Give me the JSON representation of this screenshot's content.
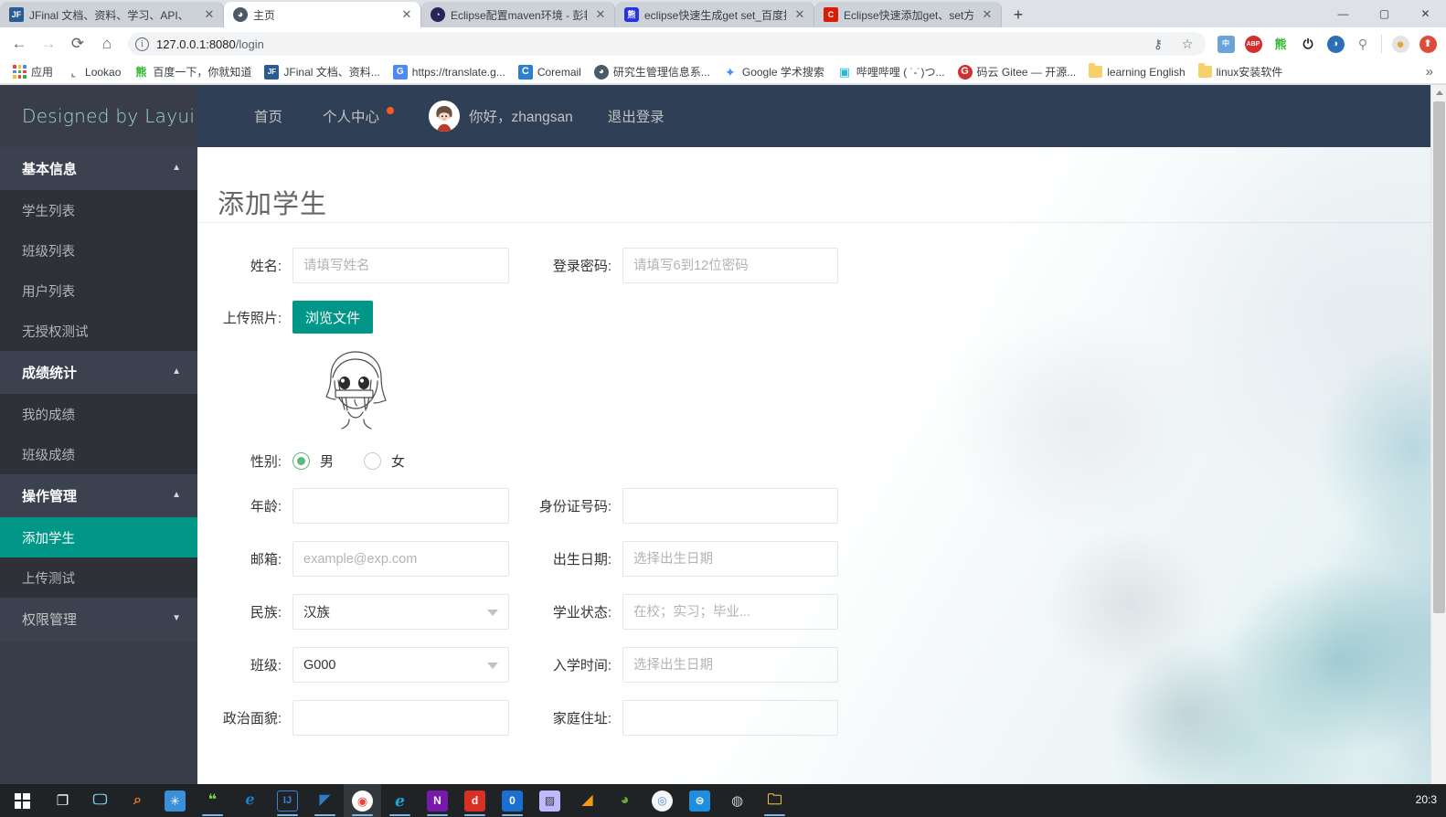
{
  "browser": {
    "tabs": [
      {
        "title": "JFinal 文档、资料、学习、API、",
        "favicon": "jfinal-icon",
        "active": false
      },
      {
        "title": "主页",
        "favicon": "home-globe-icon",
        "active": true
      },
      {
        "title": "Eclipse配置maven环境 - 彭艳 -",
        "favicon": "eclipse-icon",
        "active": false
      },
      {
        "title": "eclipse快速生成get set_百度搜索",
        "favicon": "baidu-icon",
        "active": false
      },
      {
        "title": "Eclipse快速添加get、set方法 - ",
        "favicon": "csdn-icon",
        "active": false
      }
    ],
    "new_tab_label": "+",
    "window_controls": {
      "minimize": "—",
      "maximize": "▢",
      "close": "✕"
    },
    "nav": {
      "back": "←",
      "forward": "→",
      "reload": "⟳",
      "home": "⌂"
    },
    "address": {
      "protocol_icon": "info-circle-icon",
      "host": "127.0.0.1:8080",
      "path": "/login"
    },
    "omnibox_actions": [
      {
        "name": "password-key-icon",
        "glyph": "⚷"
      },
      {
        "name": "bookmark-star-icon",
        "glyph": "☆"
      }
    ],
    "extensions": [
      {
        "name": "ime-extension-icon",
        "label": "中",
        "color": "#6aa3d8"
      },
      {
        "name": "adblock-plus-icon",
        "label": "ABP",
        "color": "#d32f2f"
      },
      {
        "name": "baidu-extension-icon",
        "label": "熊",
        "color": "#2eb82e"
      },
      {
        "name": "power-extension-icon",
        "label": "⏻",
        "color": "#2b2b2b"
      },
      {
        "name": "screenshot-extension-icon",
        "label": "◑",
        "color": "#2c6fb5"
      },
      {
        "name": "lightbulb-extension-icon",
        "label": "💡",
        "color": "#777777"
      },
      {
        "name": "profile-avatar-icon",
        "label": "●",
        "color": "#e8a33d"
      },
      {
        "name": "chrome-menu-icon",
        "label": "⬆",
        "color": "#e04a3a"
      }
    ],
    "bookmarks": [
      {
        "label": "应用",
        "icon": "apps-grid-icon"
      },
      {
        "label": "Lookao",
        "icon": "lookao-icon"
      },
      {
        "label": "百度一下，你就知道",
        "icon": "baidu-icon"
      },
      {
        "label": "JFinal 文档、资料...",
        "icon": "jfinal-icon"
      },
      {
        "label": "https://translate.g...",
        "icon": "google-translate-icon"
      },
      {
        "label": "Coremail",
        "icon": "coremail-icon"
      },
      {
        "label": "研究生管理信息系...",
        "icon": "globe-icon"
      },
      {
        "label": "Google 学术搜索",
        "icon": "google-scholar-icon"
      },
      {
        "label": "哔哩哔哩 ( ˙-˙)つ...",
        "icon": "bilibili-icon"
      },
      {
        "label": "码云 Gitee — 开源...",
        "icon": "gitee-icon"
      },
      {
        "label": "learning English",
        "icon": "folder-icon"
      },
      {
        "label": "linux安装软件",
        "icon": "folder-icon"
      }
    ],
    "bookmarks_overflow": "»"
  },
  "app": {
    "brand": "Designed by Layui",
    "header_nav": [
      {
        "label": "首页",
        "badge": false
      },
      {
        "label": "个人中心",
        "badge": true
      }
    ],
    "greeting": "你好，zhangsan",
    "logout_label": "退出登录",
    "avatar_name": "user-avatar"
  },
  "sidebar": {
    "groups": [
      {
        "title": "基本信息",
        "expanded": true,
        "caret": "▲",
        "items": [
          {
            "label": "学生列表",
            "active": false
          },
          {
            "label": "班级列表",
            "active": false
          },
          {
            "label": "用户列表",
            "active": false
          },
          {
            "label": "无授权测试",
            "active": false
          }
        ]
      },
      {
        "title": "成绩统计",
        "expanded": true,
        "caret": "▲",
        "items": [
          {
            "label": "我的成绩",
            "active": false
          },
          {
            "label": "班级成绩",
            "active": false
          }
        ]
      },
      {
        "title": "操作管理",
        "expanded": true,
        "caret": "▲",
        "items": [
          {
            "label": "添加学生",
            "active": true
          },
          {
            "label": "上传测试",
            "active": false
          }
        ]
      },
      {
        "title": "权限管理",
        "expanded": false,
        "caret": "▼",
        "items": []
      }
    ],
    "active_color": "#009688"
  },
  "page": {
    "title": "添加学生",
    "form": {
      "name": {
        "label": "姓名:",
        "value": "",
        "placeholder": "请填写姓名"
      },
      "password": {
        "label": "登录密码:",
        "value": "",
        "placeholder": "请填写6到12位密码"
      },
      "photo": {
        "label": "上传照片:",
        "button": "浏览文件",
        "preview_name": "uploaded-photo-preview"
      },
      "gender": {
        "label": "性别:",
        "options": [
          {
            "label": "男",
            "checked": true
          },
          {
            "label": "女",
            "checked": false
          }
        ]
      },
      "age": {
        "label": "年龄:",
        "value": "",
        "placeholder": ""
      },
      "id_card": {
        "label": "身份证号码:",
        "value": "",
        "placeholder": ""
      },
      "email": {
        "label": "邮箱:",
        "value": "",
        "placeholder": "example@exp.com"
      },
      "birthday": {
        "label": "出生日期:",
        "value": "",
        "placeholder": "选择出生日期"
      },
      "nation": {
        "label": "民族:",
        "value": "汉族",
        "caret": "▼"
      },
      "study_status": {
        "label": "学业状态:",
        "value": "",
        "placeholder": "在校；实习；毕业..."
      },
      "class": {
        "label": "班级:",
        "value": "G000",
        "caret": "▼"
      },
      "enroll_date": {
        "label": "入学时间:",
        "value": "",
        "placeholder": "选择出生日期"
      },
      "political": {
        "label": "政治面貌:",
        "value": "",
        "placeholder": ""
      },
      "address": {
        "label": "家庭住址:",
        "value": "",
        "placeholder": ""
      }
    }
  },
  "taskbar": {
    "start": "windows-start-icon",
    "items": [
      {
        "name": "task-view-icon",
        "label": "❐",
        "color": "#1f2326",
        "text": "#ffffff",
        "running": false
      },
      {
        "name": "this-pc-icon",
        "label": "🖳",
        "color": "#1f2326",
        "text": "#7fc5ea",
        "running": false
      },
      {
        "name": "everything-search-icon",
        "label": "🔍",
        "color": "#1f2326",
        "text": "#f07b28",
        "running": false
      },
      {
        "name": "bluetooth-icon",
        "label": "✳",
        "color": "#3a8fd8",
        "text": "#ffffff",
        "running": false
      },
      {
        "name": "wechat-icon",
        "label": "💬",
        "color": "#1f2326",
        "text": "#7bd44a",
        "running": true
      },
      {
        "name": "edge-legacy-icon",
        "label": "e",
        "color": "#1f2326",
        "text": "#1f7fc4",
        "running": false
      },
      {
        "name": "idea-icon",
        "label": "IJ",
        "color": "#1f2326",
        "text": "#3b82d6",
        "running": true
      },
      {
        "name": "vscode-icon",
        "label": "◣",
        "color": "#1f2326",
        "text": "#2f7bc5",
        "running": true
      },
      {
        "name": "chrome-icon",
        "label": "◉",
        "color": "#1f2326",
        "text": "#ea4335",
        "running": true,
        "focused": true
      },
      {
        "name": "edge-icon",
        "label": "e",
        "color": "#1f2326",
        "text": "#1ca8dd",
        "running": true
      },
      {
        "name": "onenote-icon",
        "label": "N",
        "color": "#7719aa",
        "text": "#ffffff",
        "running": true
      },
      {
        "name": "youdao-icon",
        "label": "d",
        "color": "#d93025",
        "text": "#ffffff",
        "running": true
      },
      {
        "name": "tim-qq-icon",
        "label": "0",
        "color": "#1a6fd0",
        "text": "#ffffff",
        "running": true
      },
      {
        "name": "photos-icon",
        "label": "▨",
        "color": "#c0b9ff",
        "text": "#333333",
        "running": false
      },
      {
        "name": "xmind-icon",
        "label": "◢",
        "color": "#1f2326",
        "text": "#f39c12",
        "running": false
      },
      {
        "name": "navicat-icon",
        "label": "◕",
        "color": "#1f2326",
        "text": "#6aab3f",
        "running": false
      },
      {
        "name": "typora-icon",
        "label": "◎",
        "color": "#f5f5f5",
        "text": "#4a90d9",
        "running": false
      },
      {
        "name": "xshell-icon",
        "label": "⊜",
        "color": "#1f8ede",
        "text": "#ffffff",
        "running": false
      },
      {
        "name": "vmware-icon",
        "label": "◍",
        "color": "#1f2326",
        "text": "#cccccc",
        "running": false
      },
      {
        "name": "file-explorer-icon",
        "label": "🗀",
        "color": "#1f2326",
        "text": "#f3c04a",
        "running": true
      }
    ],
    "clock": "20:3"
  }
}
